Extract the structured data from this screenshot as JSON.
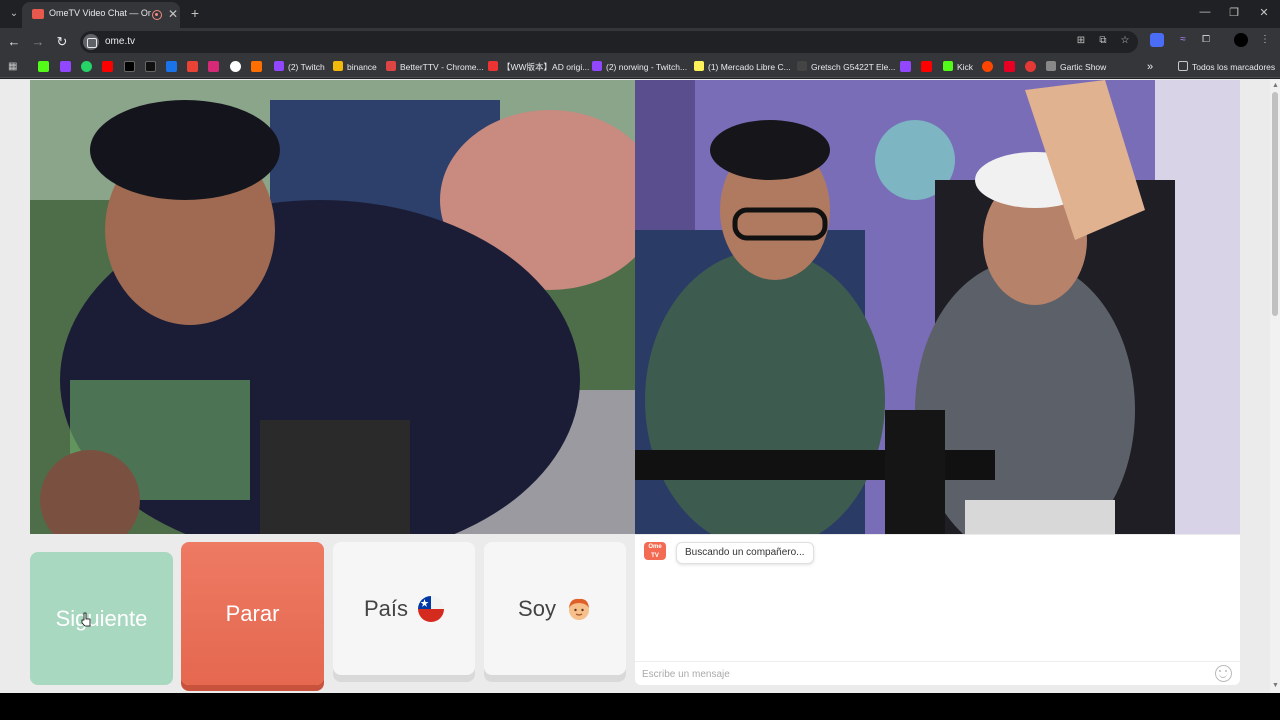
{
  "browser": {
    "tab": {
      "title": "OmeTV Video Chat — Omegle",
      "close": "✕"
    },
    "new_tab": "+",
    "url": "ome.tv",
    "window": {
      "minimize": "—",
      "restore": "❐",
      "close": "✕"
    },
    "bookmarks": [
      {
        "label": "(2) Twitch",
        "color": "#9146ff"
      },
      {
        "label": "binance",
        "color": "#f0b90b"
      },
      {
        "label": "BetterTTV - Chrome...",
        "color": "#d44"
      },
      {
        "label": "【WW版本】AD origi...",
        "color": "#e33"
      },
      {
        "label": "(2) norwing - Twitch...",
        "color": "#9146ff"
      },
      {
        "label": "(1) Mercado Libre C...",
        "color": "#fff159"
      },
      {
        "label": "Gretsch G5422T Ele...",
        "color": "#444"
      },
      {
        "label": "Kick",
        "color": "#53fc18"
      },
      {
        "label": "Gartic Show",
        "color": "#888"
      }
    ],
    "all_bookmarks": "Todos los marcadores"
  },
  "controls": {
    "next": "Siguiente",
    "stop": "Parar",
    "country": "País",
    "gender": "Soy"
  },
  "chat": {
    "logo": "Ome TV",
    "status": "Buscando un compañero...",
    "placeholder": "Escribe un mensaje"
  },
  "colors": {
    "next": "#a8d8c0",
    "stop": "#e96d55",
    "neutral": "#f6f6f6"
  }
}
